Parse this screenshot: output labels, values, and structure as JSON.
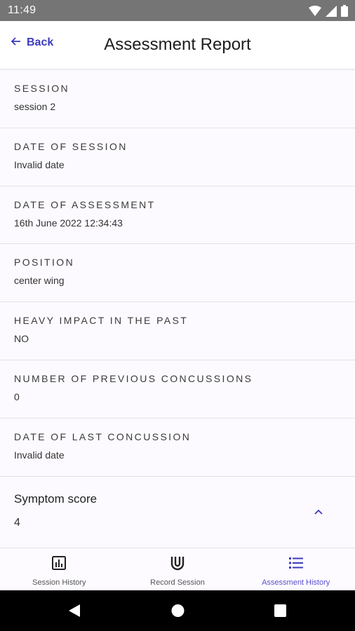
{
  "status_bar": {
    "time": "11:49"
  },
  "header": {
    "back_label": "Back",
    "title": "Assessment Report"
  },
  "fields": [
    {
      "label": "SESSION",
      "value": "session 2"
    },
    {
      "label": "DATE OF SESSION",
      "value": "Invalid date"
    },
    {
      "label": "DATE OF ASSESSMENT",
      "value": "16th June 2022 12:34:43"
    },
    {
      "label": "POSITION",
      "value": "center wing"
    },
    {
      "label": "HEAVY IMPACT IN THE PAST",
      "value": "NO"
    },
    {
      "label": "NUMBER OF PREVIOUS CONCUSSIONS",
      "value": "0"
    },
    {
      "label": "DATE OF LAST CONCUSSION",
      "value": "Invalid date"
    }
  ],
  "symptom": {
    "label": "Symptom score",
    "value": "4"
  },
  "bottom_nav": [
    {
      "label": "Session History",
      "icon": "bar-chart-icon",
      "active": false
    },
    {
      "label": "Record Session",
      "icon": "magnet-icon",
      "active": false
    },
    {
      "label": "Assessment History",
      "icon": "list-icon",
      "active": true
    }
  ],
  "colors": {
    "accent": "#3d3abf",
    "active_nav": "#5a50cf",
    "status_bar": "#757575",
    "background": "#fcfafe"
  }
}
